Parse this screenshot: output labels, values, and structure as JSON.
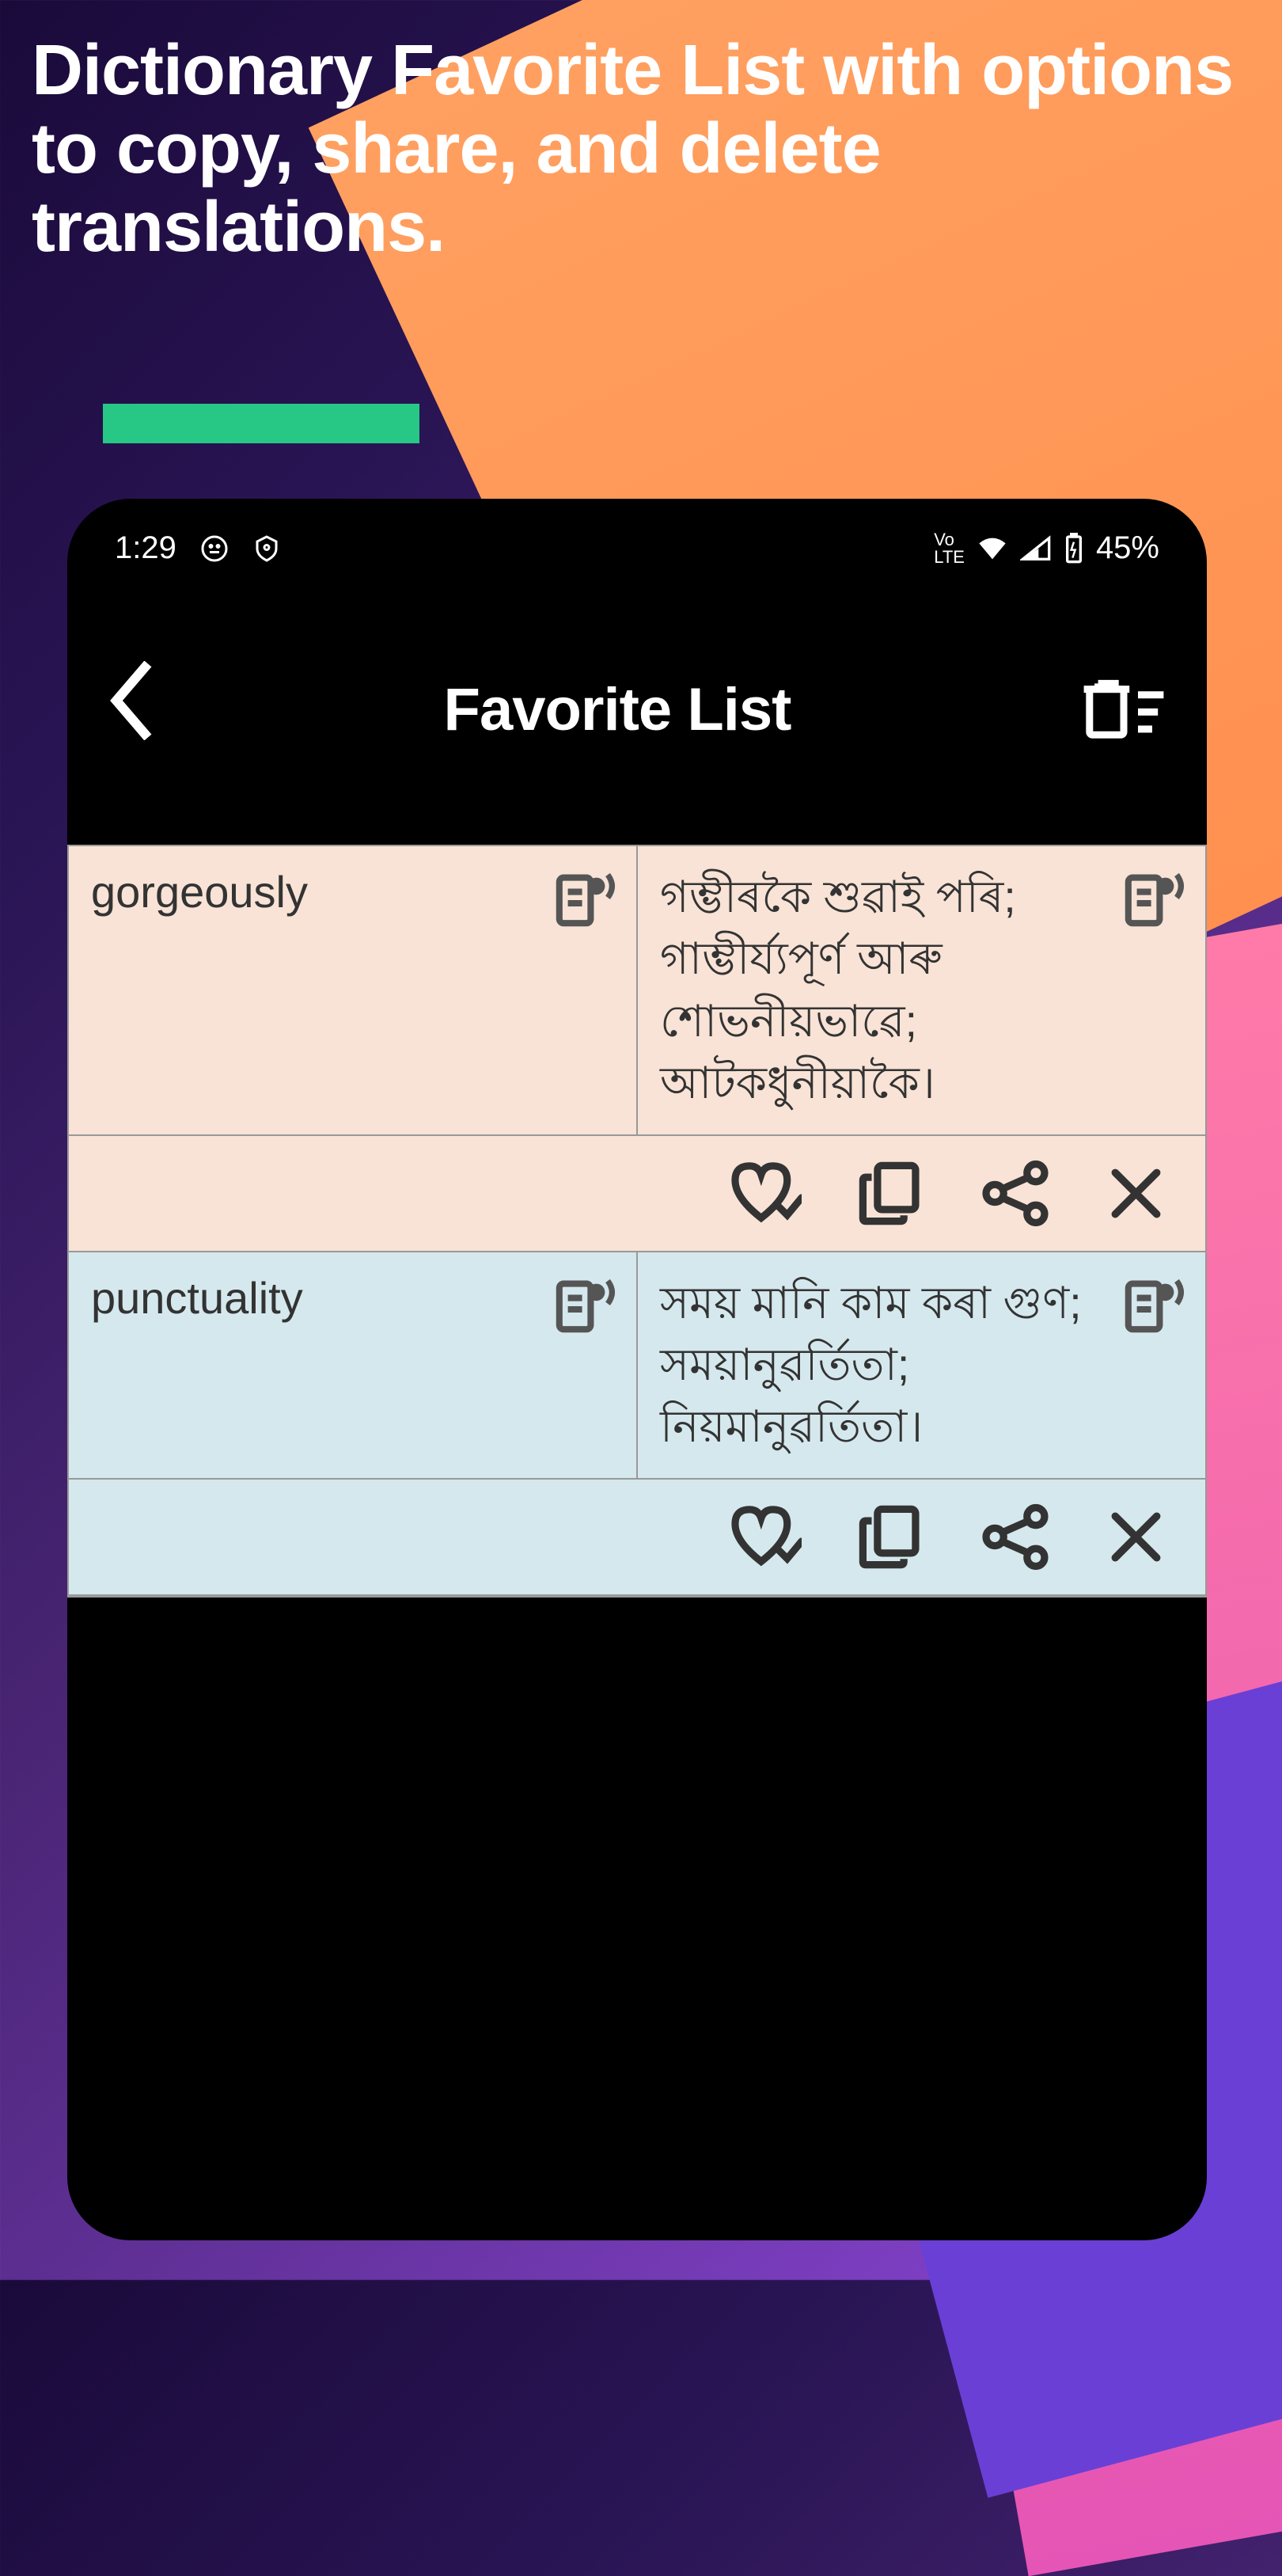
{
  "marketing": {
    "headline": "Dictionary Favorite List with options to copy, share, and delete translations."
  },
  "status": {
    "time": "1:29",
    "network": "LTE",
    "battery": "45%"
  },
  "header": {
    "title": "Favorite List"
  },
  "entries": [
    {
      "word": "gorgeously",
      "translation": "গম্ভীৰকৈ শুৱাই পৰি; গাম্ভীৰ্য্যপূৰ্ণ আৰু শোভনীয়ভাৱে; আটকধুনীয়াকৈ।",
      "color": "orange"
    },
    {
      "word": "punctuality",
      "translation": "সময় মানি কাম কৰা গুণ; সময়ানুৱৰ্তিতা; নিয়মানুৱৰ্তিতা।",
      "color": "blue"
    }
  ]
}
